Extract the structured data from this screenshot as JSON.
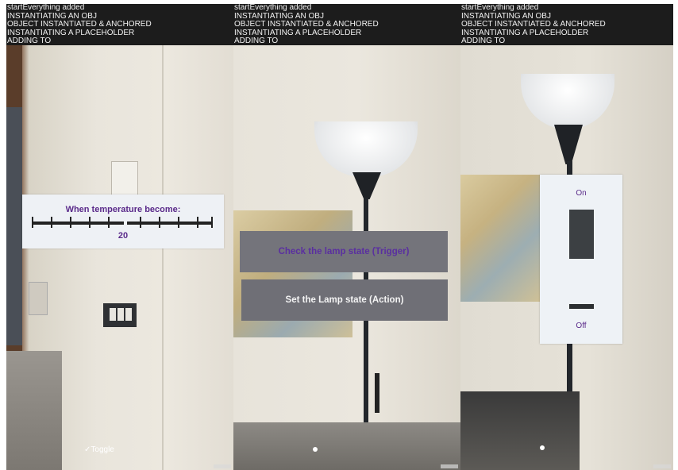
{
  "panels": [
    {
      "log_lines": [
        "startEverything added",
        "INSTANTIATING AN OBJ",
        "OBJECT INSTANTIATED & ANCHORED",
        "INSTANTIATING A PLACEHOLDER",
        "ADDING TO"
      ],
      "temperature_card": {
        "title": "When temperature become:",
        "value": "20"
      },
      "toggle_label": "Toggle"
    },
    {
      "log_lines": [
        "startEverything added",
        "INSTANTIATING AN OBJ",
        "OBJECT INSTANTIATED & ANCHORED",
        "INSTANTIATING A PLACEHOLDER",
        "ADDING TO"
      ],
      "trigger_button": "Check the lamp state (Trigger)",
      "action_button": "Set the Lamp state (Action)"
    },
    {
      "log_lines": [
        "startEverything added",
        "INSTANTIATING AN OBJ",
        "OBJECT INSTANTIATED & ANCHORED",
        "INSTANTIATING A PLACEHOLDER",
        "ADDING TO"
      ],
      "switch_card": {
        "on_label": "On",
        "off_label": "Off"
      }
    }
  ],
  "colors": {
    "accent_purple": "#5a2a8a",
    "button_gray": "#6f6f76",
    "log_background": "#1c1c1c"
  }
}
